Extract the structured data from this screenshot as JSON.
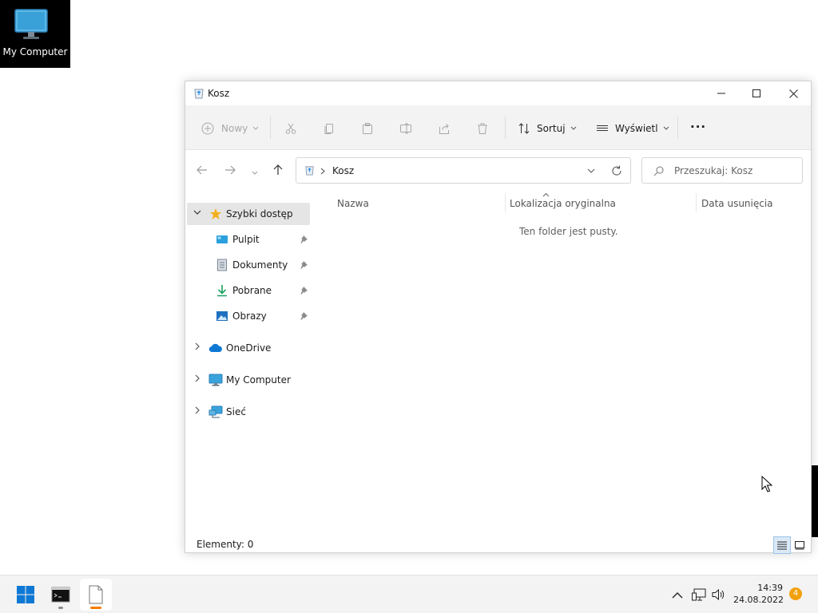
{
  "desktop": {
    "icon_label": "My Computer"
  },
  "window": {
    "title": "Kosz"
  },
  "toolbar": {
    "new_label": "Nowy",
    "sort_label": "Sortuj",
    "view_label": "Wyświetl",
    "more_label": "···"
  },
  "address": {
    "path": "Kosz"
  },
  "search": {
    "placeholder": "Przeszukaj: Kosz"
  },
  "sidebar": {
    "items": [
      {
        "label": "Szybki dostęp",
        "icon": "star-icon"
      },
      {
        "label": "Pulpit",
        "icon": "desktop-folder-icon"
      },
      {
        "label": "Dokumenty",
        "icon": "documents-icon"
      },
      {
        "label": "Pobrane",
        "icon": "download-icon"
      },
      {
        "label": "Obrazy",
        "icon": "pictures-icon"
      },
      {
        "label": "OneDrive",
        "icon": "cloud-icon"
      },
      {
        "label": "My Computer",
        "icon": "computer-icon"
      },
      {
        "label": "Sieć",
        "icon": "network-icon"
      }
    ]
  },
  "columns": {
    "name": "Nazwa",
    "location": "Lokalizacja oryginalna",
    "deleted": "Data usunięcia"
  },
  "content": {
    "empty_message": "Ten folder jest pusty."
  },
  "status": {
    "count": "Elementy: 0"
  },
  "taskbar": {
    "time": "14:39",
    "date": "24.08.2022",
    "notifications": "4"
  },
  "colors": {
    "accent": "#0078d4",
    "star": "#f2b01e",
    "taskbar_active_indicator": "#f57c00",
    "notification_badge": "#f2a10f"
  }
}
